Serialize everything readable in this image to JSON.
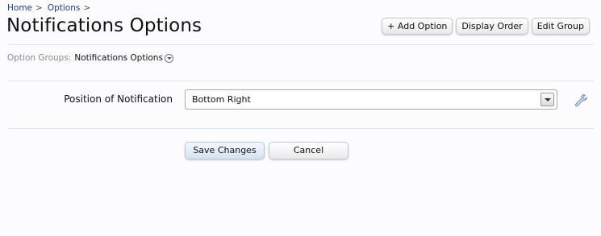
{
  "breadcrumb": {
    "items": [
      "Home",
      "Options"
    ],
    "separator": ">"
  },
  "page": {
    "title": "Notifications Options"
  },
  "toolbar": {
    "add_option": "+ Add Option",
    "display_order": "Display Order",
    "edit_group": "Edit Group"
  },
  "option_groups": {
    "label": "Option Groups:",
    "value": "Notifications Options"
  },
  "form": {
    "field_label": "Position of Notification",
    "select_value": "Bottom Right",
    "edit_icon": "wrench-icon"
  },
  "actions": {
    "save": "Save Changes",
    "cancel": "Cancel"
  },
  "colors": {
    "link": "#1f3f7a",
    "divider": "#dde5ee",
    "primary_button": "#d4e3f1"
  }
}
